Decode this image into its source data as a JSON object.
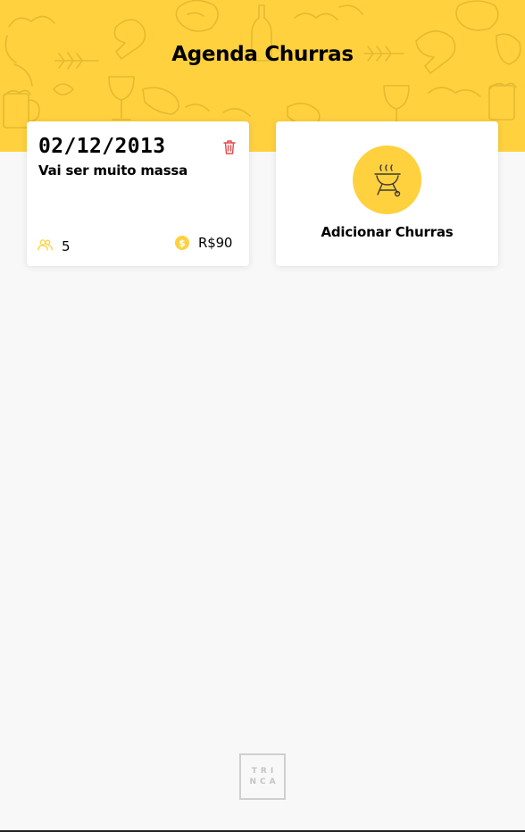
{
  "header": {
    "title": "Agenda Churras"
  },
  "events": [
    {
      "date": "02/12/2013",
      "title": "Vai ser muito massa",
      "guests": "5",
      "amount": "R$90"
    }
  ],
  "add_card": {
    "label": "Adicionar Churras"
  },
  "logo": {
    "line1": "TRI",
    "line2": "NCA"
  },
  "colors": {
    "accent": "#ffd13e",
    "danger": "#e5484d",
    "background": "#f8f8f8"
  }
}
